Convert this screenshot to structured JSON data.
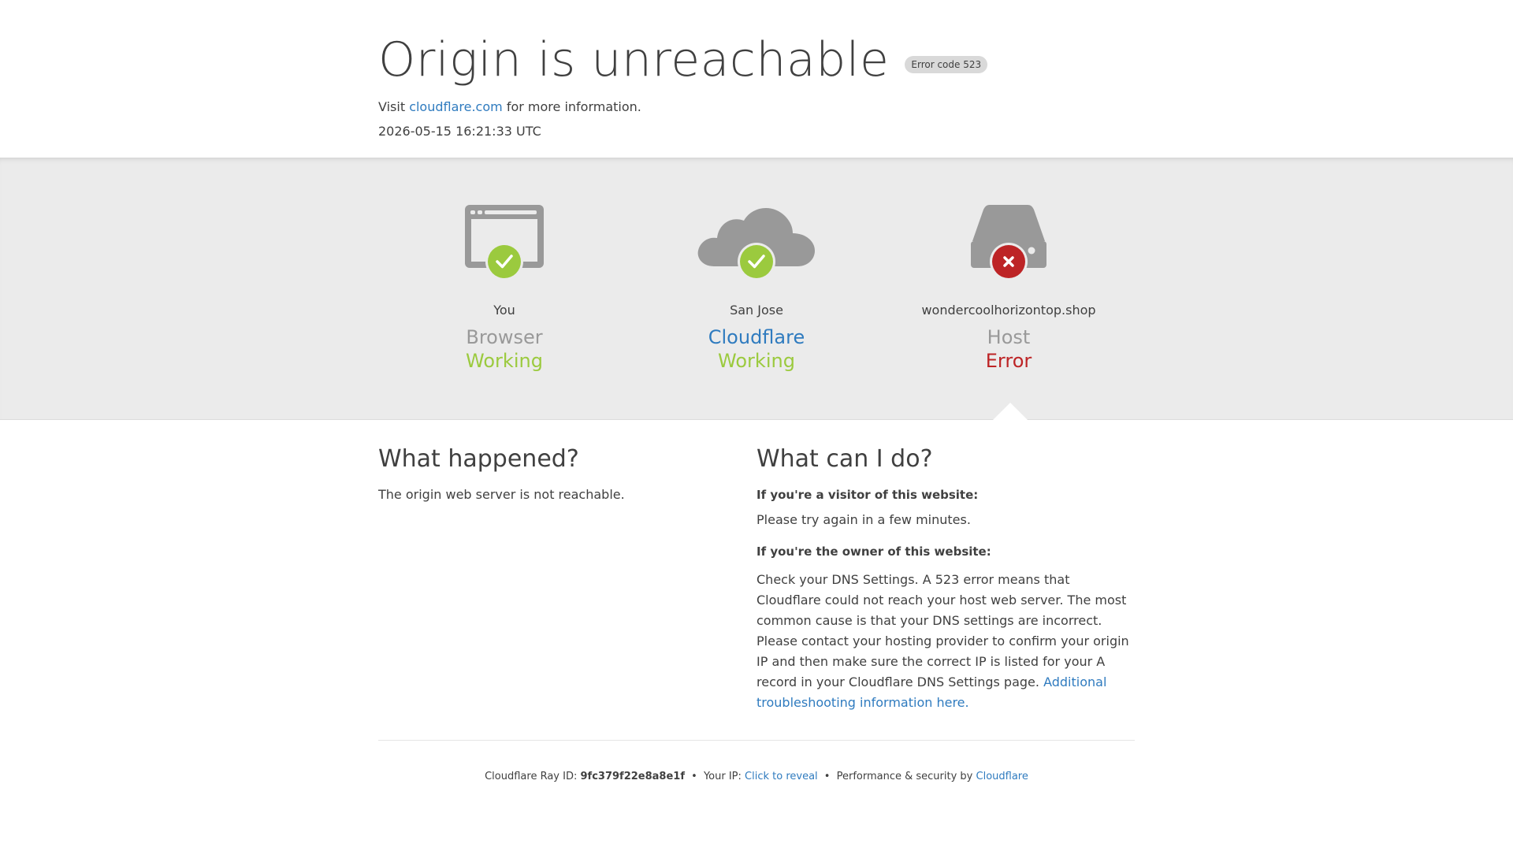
{
  "header": {
    "title": "Origin is unreachable",
    "error_badge": "Error code 523",
    "visit_prefix": "Visit",
    "visit_link": "cloudflare.com",
    "visit_suffix": "for more information.",
    "timestamp": "2026-05-15 16:21:33 UTC"
  },
  "status": [
    {
      "location": "You",
      "role": "Browser",
      "state": "Working",
      "icon": "browser-icon",
      "result_icon": "check-icon"
    },
    {
      "location": "San Jose",
      "role": "Cloudflare",
      "state": "Working",
      "icon": "cloud-icon",
      "result_icon": "check-icon"
    },
    {
      "location": "wondercoolhorizontop.shop",
      "role": "Host",
      "state": "Error",
      "icon": "server-icon",
      "result_icon": "x-icon"
    }
  ],
  "what_happened": {
    "heading": "What happened?",
    "text": "The origin web server is not reachable."
  },
  "what_can_i_do": {
    "heading": "What can I do?",
    "visitor_heading": "If you're a visitor of this website:",
    "visitor_text": "Please try again in a few minutes.",
    "owner_heading": "If you're the owner of this website:",
    "owner_text": "Check your DNS Settings. A 523 error means that Cloudflare could not reach your host web server. The most common cause is that your DNS settings are incorrect. Please contact your hosting provider to confirm your origin IP and then make sure the correct IP is listed for your A record in your Cloudflare DNS Settings page.",
    "owner_link": "Additional troubleshooting information here."
  },
  "footer": {
    "ray_label": "Cloudflare Ray ID:",
    "ray_id": "9fc379f22e8a8e1f",
    "separator": "•",
    "ip_label": "Your IP:",
    "ip_link": "Click to reveal",
    "perf_label": "Performance & security by",
    "perf_link": "Cloudflare"
  },
  "colors": {
    "ok": "#9bca3e",
    "error": "#bd2426",
    "link": "#2f7bbf",
    "icon_gray": "#999999",
    "band_bg": "#ebebeb"
  }
}
